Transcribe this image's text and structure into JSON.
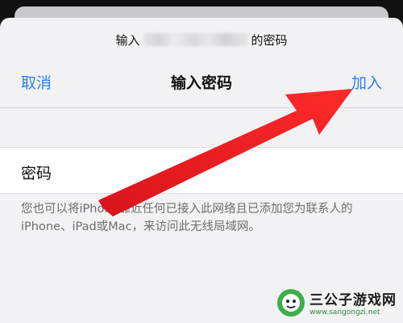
{
  "sheet": {
    "subtitle_prefix": "输入",
    "subtitle_suffix": "的密码"
  },
  "navbar": {
    "cancel_label": "取消",
    "title": "输入密码",
    "join_label": "加入"
  },
  "form": {
    "password_label": "密码",
    "password_value": ""
  },
  "hint_text": "您也可以将iPhone靠近任何已接入此网络且已添加您为联系人的iPhone、iPad或Mac，来访问此无线局域网。",
  "watermark": {
    "name": "三公子游戏网",
    "url": "www.sangongzi.net"
  },
  "colors": {
    "accent": "#2a7ff0",
    "annotation_arrow": "#ee1c24",
    "sheet_background": "#f2f2f4"
  },
  "icons": [
    "annotation-arrow",
    "watermark-logo"
  ]
}
